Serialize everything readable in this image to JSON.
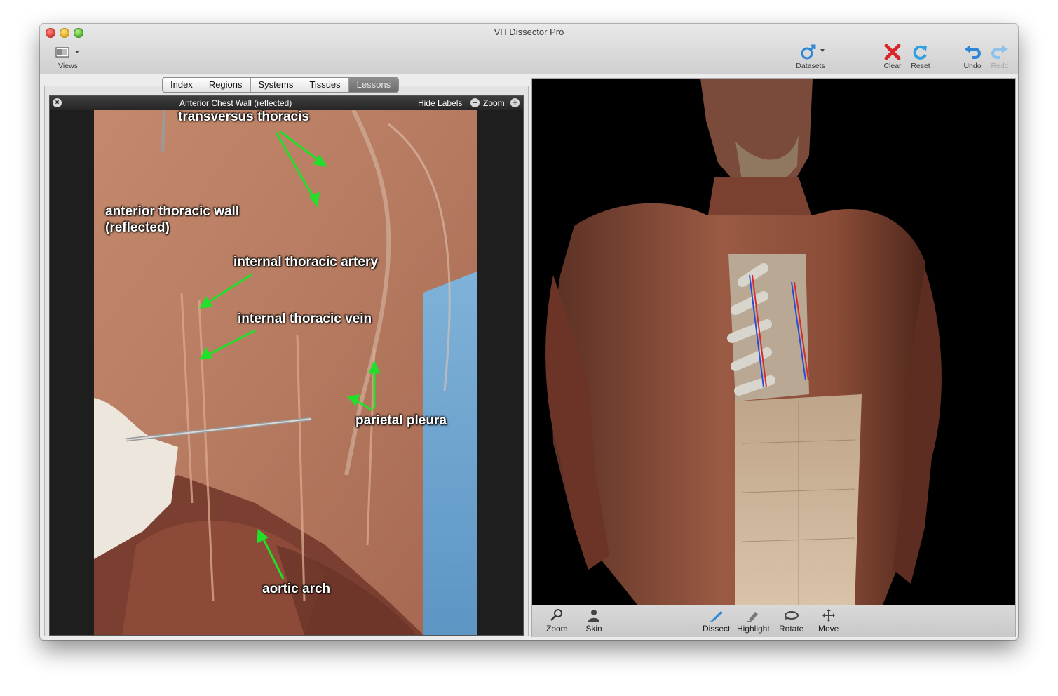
{
  "window": {
    "title": "VH Dissector Pro"
  },
  "toolbar": {
    "views_label": "Views",
    "datasets_label": "Datasets",
    "clear_label": "Clear",
    "reset_label": "Reset",
    "undo_label": "Undo",
    "redo_label": "Redo"
  },
  "tabs": [
    "Index",
    "Regions",
    "Systems",
    "Tissues",
    "Lessons"
  ],
  "active_tab": "Lessons",
  "viewer": {
    "title": "Anterior Chest Wall (reflected)",
    "hide_labels": "Hide Labels",
    "zoom_label": "Zoom",
    "labels": {
      "transversus": "transversus thoracis",
      "anterior_line1": "anterior thoracic wall",
      "anterior_line2": "(reflected)",
      "artery": "internal thoracic artery",
      "vein": "internal thoracic vein",
      "pleura": "parietal pleura",
      "aortic": "aortic arch"
    }
  },
  "bottom_tools": {
    "zoom": "Zoom",
    "skin": "Skin",
    "dissect": "Dissect",
    "highlight": "Highlight",
    "rotate": "Rotate",
    "move": "Move"
  },
  "colors": {
    "arrow": "#22e02a",
    "muscle": "#8a4a36",
    "accent_blue": "#2f86d6",
    "clear_red": "#d9262b"
  },
  "icons": {
    "views": "views-icon",
    "datasets": "datasets-icon",
    "clear": "clear-icon",
    "reset": "reset-icon",
    "undo": "undo-icon",
    "redo": "redo-icon"
  }
}
